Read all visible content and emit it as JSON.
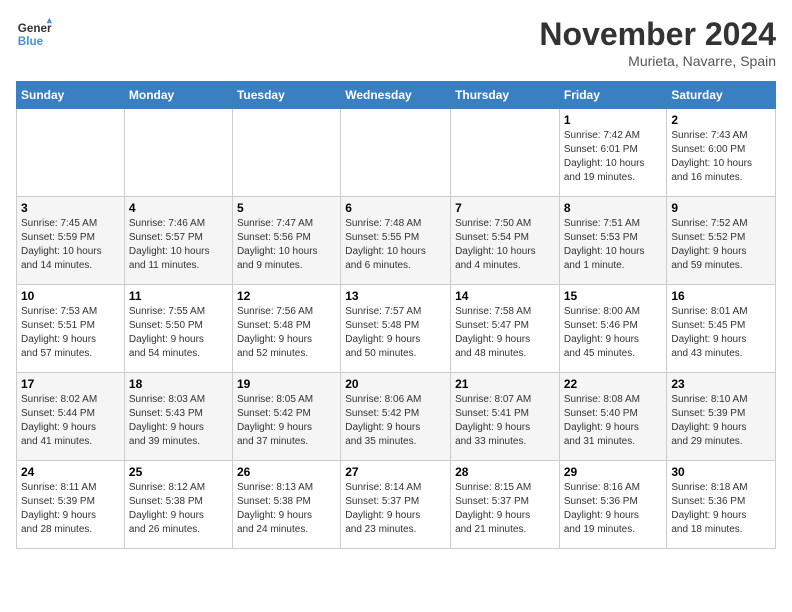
{
  "logo": {
    "line1": "General",
    "line2": "Blue"
  },
  "title": "November 2024",
  "subtitle": "Murieta, Navarre, Spain",
  "days_of_week": [
    "Sunday",
    "Monday",
    "Tuesday",
    "Wednesday",
    "Thursday",
    "Friday",
    "Saturday"
  ],
  "weeks": [
    [
      {
        "day": "",
        "info": ""
      },
      {
        "day": "",
        "info": ""
      },
      {
        "day": "",
        "info": ""
      },
      {
        "day": "",
        "info": ""
      },
      {
        "day": "",
        "info": ""
      },
      {
        "day": "1",
        "info": "Sunrise: 7:42 AM\nSunset: 6:01 PM\nDaylight: 10 hours\nand 19 minutes."
      },
      {
        "day": "2",
        "info": "Sunrise: 7:43 AM\nSunset: 6:00 PM\nDaylight: 10 hours\nand 16 minutes."
      }
    ],
    [
      {
        "day": "3",
        "info": "Sunrise: 7:45 AM\nSunset: 5:59 PM\nDaylight: 10 hours\nand 14 minutes."
      },
      {
        "day": "4",
        "info": "Sunrise: 7:46 AM\nSunset: 5:57 PM\nDaylight: 10 hours\nand 11 minutes."
      },
      {
        "day": "5",
        "info": "Sunrise: 7:47 AM\nSunset: 5:56 PM\nDaylight: 10 hours\nand 9 minutes."
      },
      {
        "day": "6",
        "info": "Sunrise: 7:48 AM\nSunset: 5:55 PM\nDaylight: 10 hours\nand 6 minutes."
      },
      {
        "day": "7",
        "info": "Sunrise: 7:50 AM\nSunset: 5:54 PM\nDaylight: 10 hours\nand 4 minutes."
      },
      {
        "day": "8",
        "info": "Sunrise: 7:51 AM\nSunset: 5:53 PM\nDaylight: 10 hours\nand 1 minute."
      },
      {
        "day": "9",
        "info": "Sunrise: 7:52 AM\nSunset: 5:52 PM\nDaylight: 9 hours\nand 59 minutes."
      }
    ],
    [
      {
        "day": "10",
        "info": "Sunrise: 7:53 AM\nSunset: 5:51 PM\nDaylight: 9 hours\nand 57 minutes."
      },
      {
        "day": "11",
        "info": "Sunrise: 7:55 AM\nSunset: 5:50 PM\nDaylight: 9 hours\nand 54 minutes."
      },
      {
        "day": "12",
        "info": "Sunrise: 7:56 AM\nSunset: 5:48 PM\nDaylight: 9 hours\nand 52 minutes."
      },
      {
        "day": "13",
        "info": "Sunrise: 7:57 AM\nSunset: 5:48 PM\nDaylight: 9 hours\nand 50 minutes."
      },
      {
        "day": "14",
        "info": "Sunrise: 7:58 AM\nSunset: 5:47 PM\nDaylight: 9 hours\nand 48 minutes."
      },
      {
        "day": "15",
        "info": "Sunrise: 8:00 AM\nSunset: 5:46 PM\nDaylight: 9 hours\nand 45 minutes."
      },
      {
        "day": "16",
        "info": "Sunrise: 8:01 AM\nSunset: 5:45 PM\nDaylight: 9 hours\nand 43 minutes."
      }
    ],
    [
      {
        "day": "17",
        "info": "Sunrise: 8:02 AM\nSunset: 5:44 PM\nDaylight: 9 hours\nand 41 minutes."
      },
      {
        "day": "18",
        "info": "Sunrise: 8:03 AM\nSunset: 5:43 PM\nDaylight: 9 hours\nand 39 minutes."
      },
      {
        "day": "19",
        "info": "Sunrise: 8:05 AM\nSunset: 5:42 PM\nDaylight: 9 hours\nand 37 minutes."
      },
      {
        "day": "20",
        "info": "Sunrise: 8:06 AM\nSunset: 5:42 PM\nDaylight: 9 hours\nand 35 minutes."
      },
      {
        "day": "21",
        "info": "Sunrise: 8:07 AM\nSunset: 5:41 PM\nDaylight: 9 hours\nand 33 minutes."
      },
      {
        "day": "22",
        "info": "Sunrise: 8:08 AM\nSunset: 5:40 PM\nDaylight: 9 hours\nand 31 minutes."
      },
      {
        "day": "23",
        "info": "Sunrise: 8:10 AM\nSunset: 5:39 PM\nDaylight: 9 hours\nand 29 minutes."
      }
    ],
    [
      {
        "day": "24",
        "info": "Sunrise: 8:11 AM\nSunset: 5:39 PM\nDaylight: 9 hours\nand 28 minutes."
      },
      {
        "day": "25",
        "info": "Sunrise: 8:12 AM\nSunset: 5:38 PM\nDaylight: 9 hours\nand 26 minutes."
      },
      {
        "day": "26",
        "info": "Sunrise: 8:13 AM\nSunset: 5:38 PM\nDaylight: 9 hours\nand 24 minutes."
      },
      {
        "day": "27",
        "info": "Sunrise: 8:14 AM\nSunset: 5:37 PM\nDaylight: 9 hours\nand 23 minutes."
      },
      {
        "day": "28",
        "info": "Sunrise: 8:15 AM\nSunset: 5:37 PM\nDaylight: 9 hours\nand 21 minutes."
      },
      {
        "day": "29",
        "info": "Sunrise: 8:16 AM\nSunset: 5:36 PM\nDaylight: 9 hours\nand 19 minutes."
      },
      {
        "day": "30",
        "info": "Sunrise: 8:18 AM\nSunset: 5:36 PM\nDaylight: 9 hours\nand 18 minutes."
      }
    ]
  ]
}
